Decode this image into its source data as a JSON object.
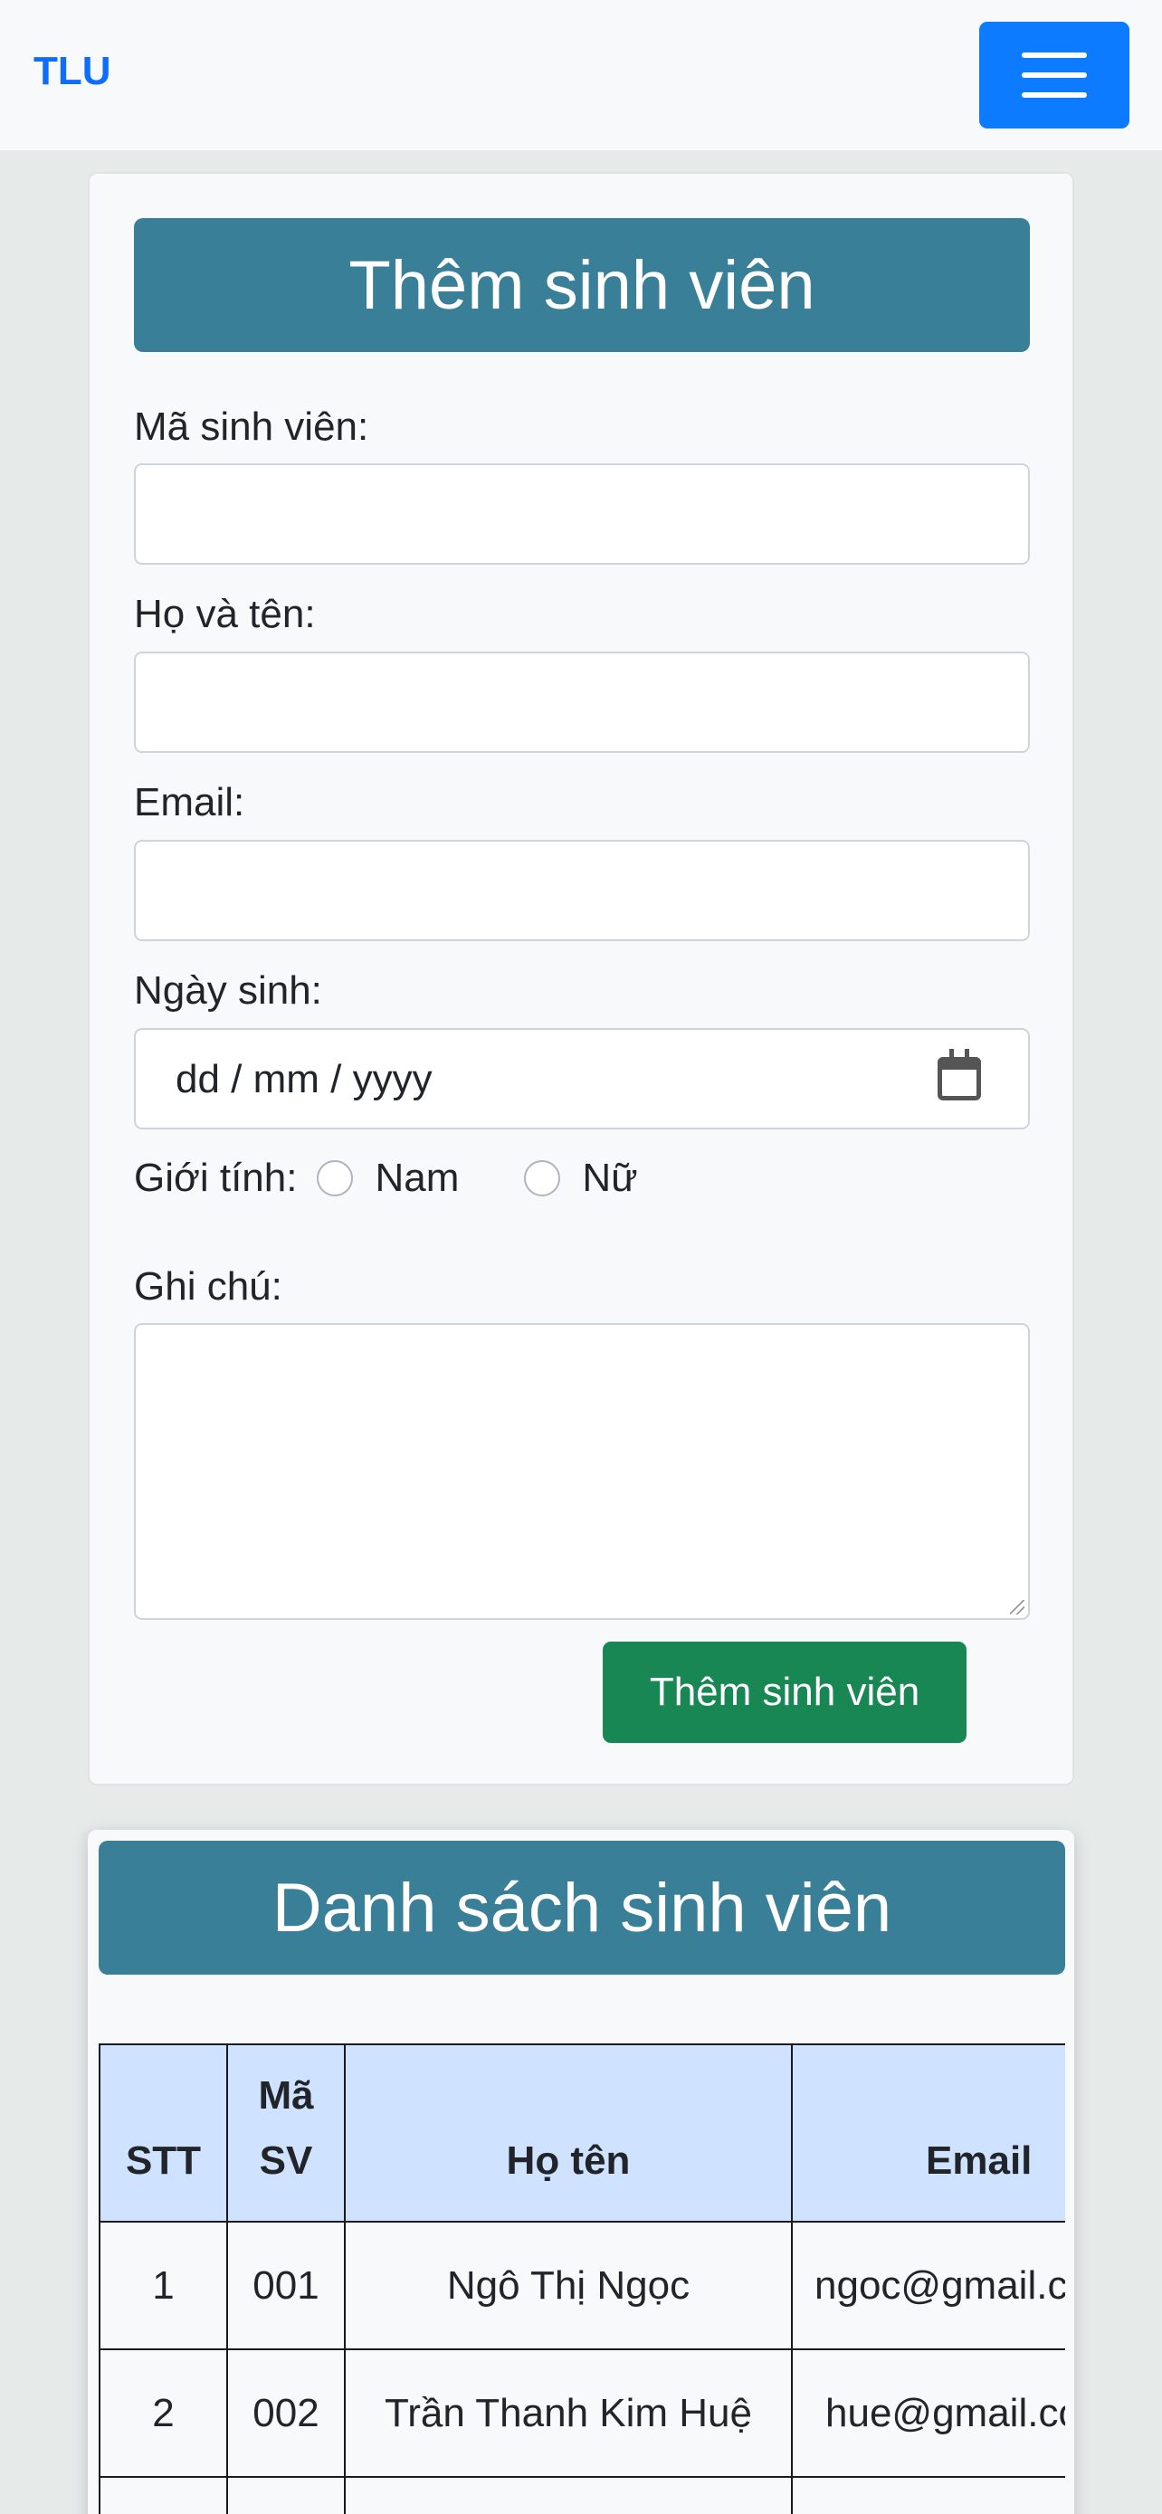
{
  "navbar": {
    "brand": "TLU",
    "menu_icon": "hamburger-menu-icon"
  },
  "form": {
    "title": "Thêm sinh viên",
    "student_id_label": "Mã sinh viên:",
    "fullname_label": "Họ và tên:",
    "email_label": "Email:",
    "dob_label": "Ngày sinh:",
    "dob_placeholder": "dd / mm / yyyy",
    "dob_icon": "calendar-icon",
    "gender_label": "Giới tính:",
    "gender_options": [
      "Nam",
      "Nữ"
    ],
    "note_label": "Ghi chú:",
    "submit_label": "Thêm sinh viên"
  },
  "list": {
    "title": "Danh sách sinh viên",
    "headers": [
      "STT",
      "Mã SV",
      "Họ tên",
      "Email"
    ],
    "rows": [
      {
        "stt": "1",
        "id": "001",
        "name": "Ngô Thị Ngọc",
        "email": "ngoc@gmail.com"
      },
      {
        "stt": "2",
        "id": "002",
        "name": "Trần Thanh Kim Huệ",
        "email": "hue@gmail.com"
      },
      {
        "stt": "",
        "id": "",
        "name": "",
        "email": ""
      }
    ]
  },
  "colors": {
    "navbar_bg": "#f8f9fa",
    "brand": "#0d6efd",
    "toggler": "#0d7bff",
    "header_bg": "#3a7f98",
    "submit_bg": "#198754",
    "table_header_bg": "#cfe2ff",
    "page_bg": "#e6ebea"
  }
}
